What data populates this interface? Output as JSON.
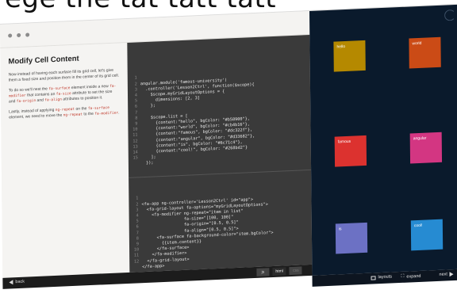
{
  "top_text": "ege the tat tatt tatt",
  "lesson": {
    "title": "Modify Cell Content",
    "p1": "Now instead of having each surface fill its grid cell, let's give them a fixed size and position them in the center of its grid cell.",
    "p2_a": "To do so we'll nest the ",
    "p2_code1": "fa-surface",
    "p2_b": " element inside a new ",
    "p2_code2": "fa-modifier",
    "p2_c": " that contains an ",
    "p2_code3": "fa-size",
    "p2_d": " attribute to set the size and ",
    "p2_code4": "fa-origin",
    "p2_e": " and ",
    "p2_code5": "fa-align",
    "p2_f": " attributes to position it.",
    "p3_a": "Lastly, instead of applying ",
    "p3_code1": "ng-repeat",
    "p3_b": " on the ",
    "p3_code2": "fa-surface",
    "p3_c": " element, we need to move the ",
    "p3_code3": "ng-repeat",
    "p3_d": " to the ",
    "p3_code4": "fa-modifier",
    "p3_e": "."
  },
  "js_code": {
    "lines": [
      "angular.module('famous-university')",
      "  .controller('Lesson2Ctrl', function($scope){",
      "    $scope.myGridLayoutOptions = {",
      "      dimensions: [2, 3]",
      "    };",
      "",
      "    $scope.list = [",
      "      {content:\"hello\", bgColor: \"#b58900\"},",
      "      {content:\"world\", bgColor: \"#cb4b16\"},",
      "      {content:\"famous\", bgColor: \"#dc322f\"},",
      "      {content:\"angular\", bgColor: \"#d33682\"},",
      "      {content:\"is\", bgColor: \"#6c71c4\"},",
      "      {content:\"cool!\", bgColor: \"#268bd2\"}",
      "    ];",
      "  });"
    ]
  },
  "html_code": {
    "lines": [
      "<fa-app ng-controller='Lesson2Ctrl' id=\"app\">",
      "  <fa-grid-layout fa-options=\"myGridLayoutOptions\">",
      "    <fa-modifier ng-repeat=\"item in list\"",
      "                 fa-size=\"[100, 100]\"",
      "                 fa-origin=\"[0.5, 0.5]\"",
      "                 fa-align=\"[0.5, 0.5]\">",
      "      <fa-surface fa-background-color=\"item.bgColor\">",
      "        {{item.content}}",
      "      </fa-surface>",
      "    </fa-modifier>",
      "  </fa-grid-layout>",
      "</fa-app>"
    ]
  },
  "editor_tabs": [
    "js",
    "html",
    "css"
  ],
  "nav": {
    "back": "back",
    "layouts": "layouts",
    "expand": "expand",
    "next": "next"
  },
  "cells": [
    {
      "content": "hello",
      "color": "#b58900"
    },
    {
      "content": "world",
      "color": "#cb4b16"
    },
    {
      "content": "famous",
      "color": "#dc322f"
    },
    {
      "content": "angular",
      "color": "#d33682"
    },
    {
      "content": "is",
      "color": "#6c71c4"
    },
    {
      "content": "cool!",
      "color": "#268bd2"
    }
  ]
}
